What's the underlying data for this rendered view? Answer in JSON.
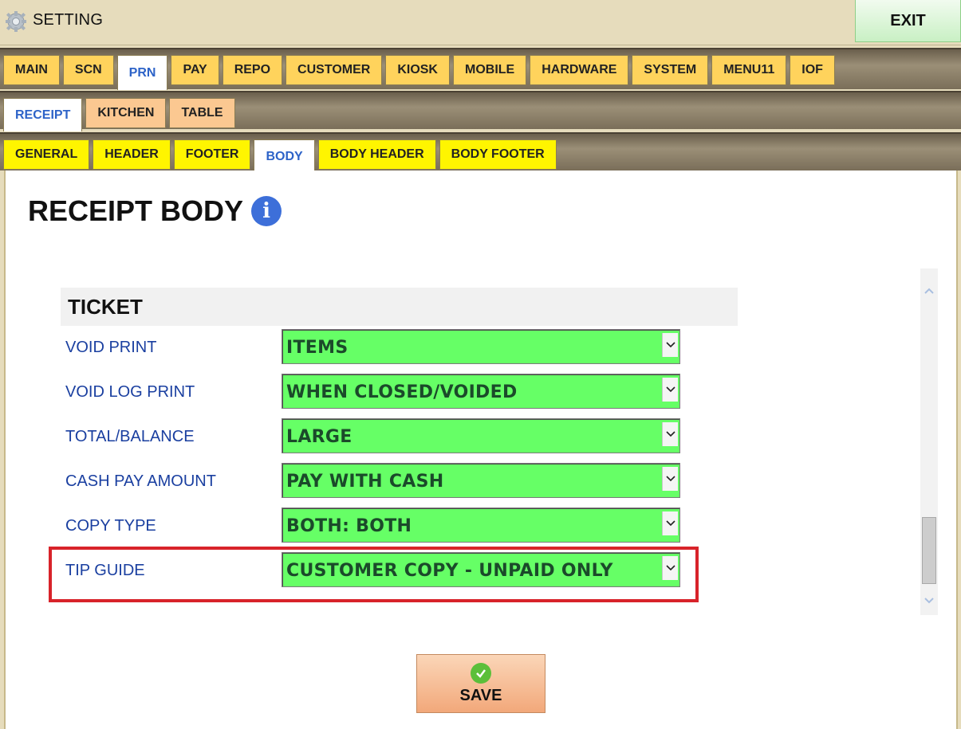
{
  "window": {
    "title": "SETTING",
    "exit_label": "EXIT"
  },
  "main_tabs": [
    "MAIN",
    "SCN",
    "PRN",
    "PAY",
    "REPO",
    "CUSTOMER",
    "KIOSK",
    "MOBILE",
    "HARDWARE",
    "SYSTEM",
    "MENU11",
    "IOF"
  ],
  "main_tabs_active": "PRN",
  "sub_tabs": [
    "RECEIPT",
    "KITCHEN",
    "TABLE"
  ],
  "sub_tabs_active": "RECEIPT",
  "section_tabs": [
    "GENERAL",
    "HEADER",
    "FOOTER",
    "BODY",
    "BODY HEADER",
    "BODY FOOTER"
  ],
  "section_tabs_active": "BODY",
  "page": {
    "heading": "RECEIPT BODY",
    "section_title": "TICKET"
  },
  "fields": [
    {
      "label": "VOID PRINT",
      "value": "ITEMS"
    },
    {
      "label": "VOID LOG PRINT",
      "value": "WHEN CLOSED/VOIDED"
    },
    {
      "label": "TOTAL/BALANCE",
      "value": "LARGE"
    },
    {
      "label": "CASH PAY AMOUNT",
      "value": "PAY WITH CASH"
    },
    {
      "label": "COPY TYPE",
      "value": "BOTH: BOTH"
    },
    {
      "label": "TIP GUIDE",
      "value": "CUSTOMER COPY - UNPAID ONLY"
    }
  ],
  "save_label": "SAVE",
  "colors": {
    "select_bg": "#66ff66",
    "highlight": "#d8232a",
    "active_tab_text": "#2d63c8"
  }
}
